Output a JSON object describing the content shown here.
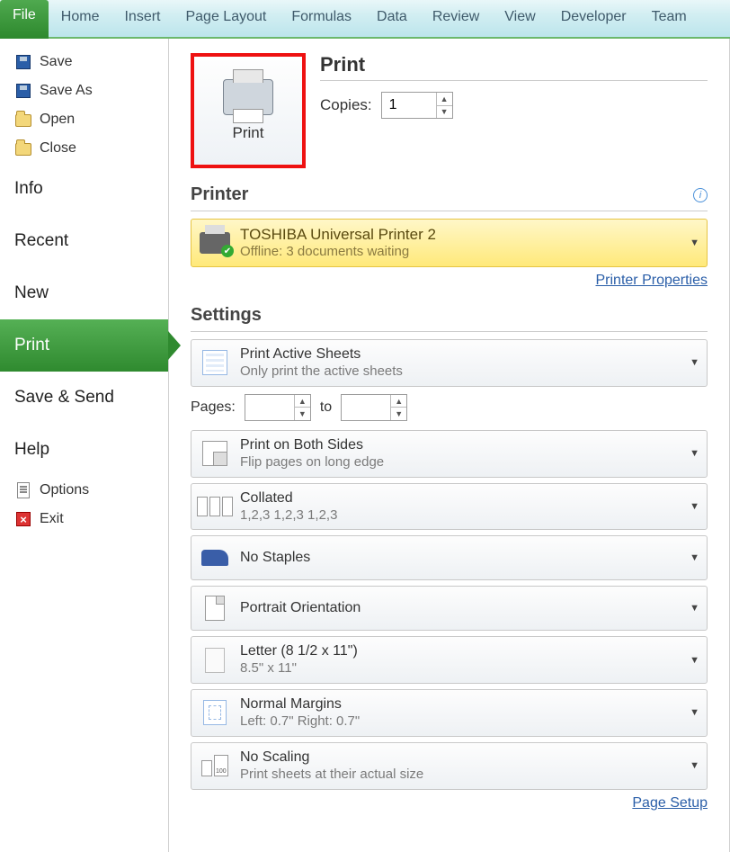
{
  "ribbon": {
    "tabs": [
      "File",
      "Home",
      "Insert",
      "Page Layout",
      "Formulas",
      "Data",
      "Review",
      "View",
      "Developer",
      "Team"
    ],
    "active": "File"
  },
  "nav": {
    "file_items": {
      "save": "Save",
      "save_as": "Save As",
      "open": "Open",
      "close": "Close"
    },
    "sections": {
      "info": "Info",
      "recent": "Recent",
      "new": "New",
      "print": "Print",
      "save_send": "Save & Send",
      "help": "Help"
    },
    "bottom": {
      "options": "Options",
      "exit": "Exit"
    }
  },
  "print": {
    "button_label": "Print",
    "heading": "Print",
    "copies_label": "Copies:",
    "copies_value": "1"
  },
  "printer": {
    "heading": "Printer",
    "name": "TOSHIBA Universal Printer 2",
    "status": "Offline: 3 documents waiting",
    "properties_link": "Printer Properties"
  },
  "settings": {
    "heading": "Settings",
    "active_sheets": {
      "title": "Print Active Sheets",
      "sub": "Only print the active sheets"
    },
    "pages_label": "Pages:",
    "pages_to": "to",
    "duplex": {
      "title": "Print on Both Sides",
      "sub": "Flip pages on long edge"
    },
    "collate": {
      "title": "Collated",
      "sub": "1,2,3    1,2,3    1,2,3"
    },
    "staples": {
      "title": "No Staples"
    },
    "orientation": {
      "title": "Portrait Orientation"
    },
    "paper": {
      "title": "Letter (8 1/2 x 11\")",
      "sub": "8.5\" x 11\""
    },
    "margins": {
      "title": "Normal Margins",
      "sub": "Left:  0.7\"   Right:  0.7\""
    },
    "scaling": {
      "title": "No Scaling",
      "sub": "Print sheets at their actual size"
    },
    "page_setup_link": "Page Setup"
  }
}
